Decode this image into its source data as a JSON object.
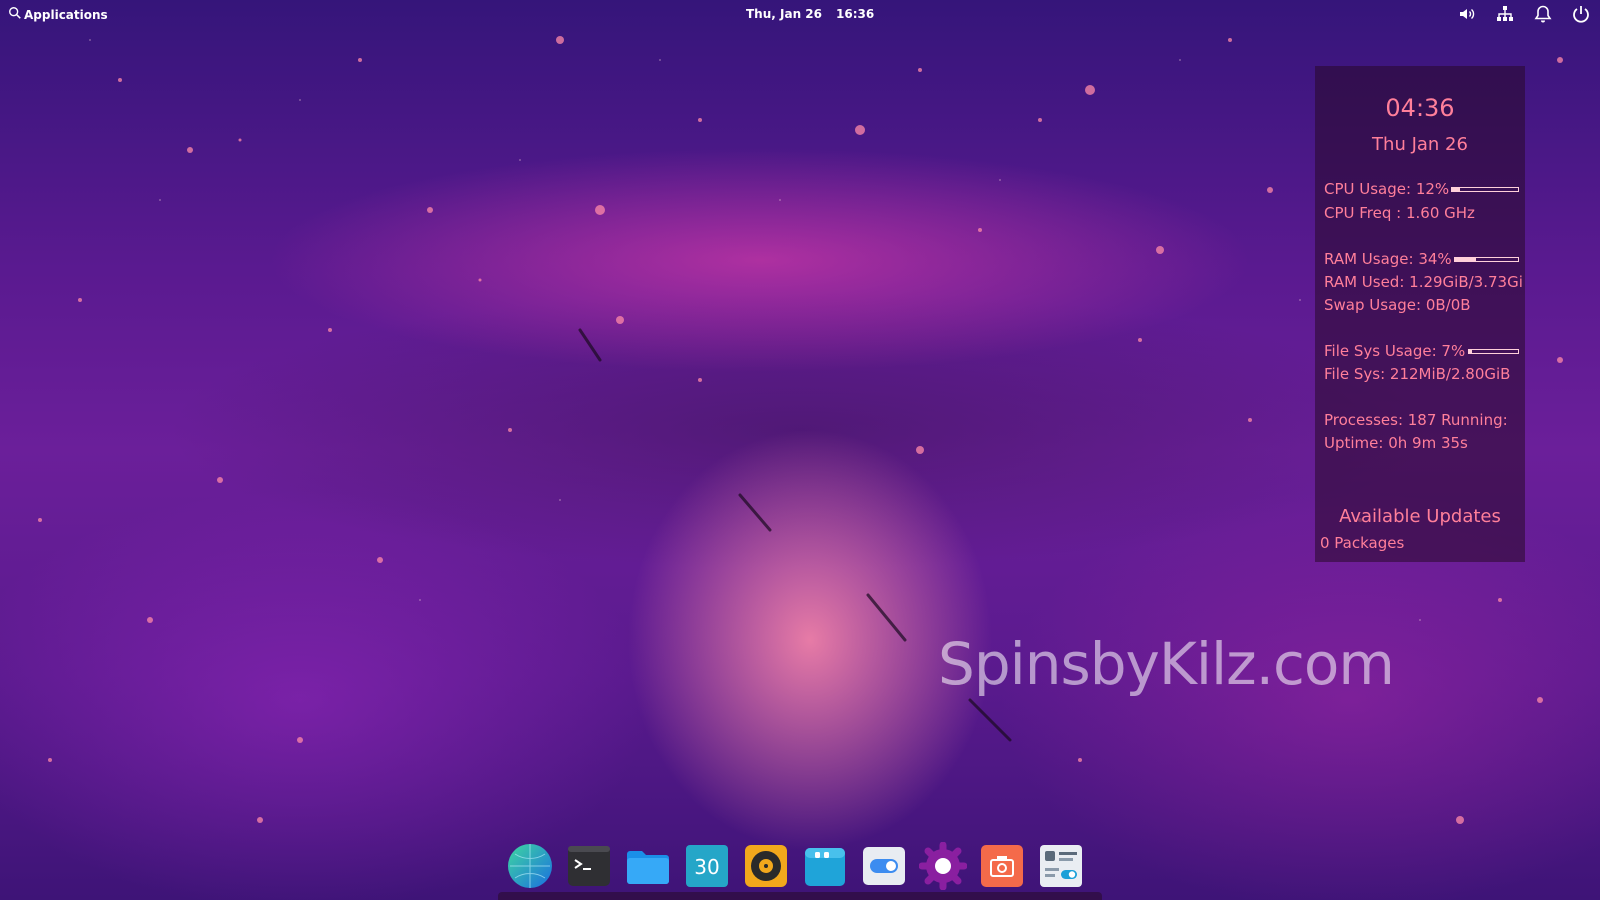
{
  "top_panel": {
    "apps_label": "Applications",
    "date": "Thu, Jan 26",
    "time": "16:36",
    "indicators": [
      {
        "icon": "speaker-icon"
      },
      {
        "icon": "network-icon"
      },
      {
        "icon": "bell-icon"
      },
      {
        "icon": "power-icon"
      }
    ]
  },
  "conky": {
    "time": "04:36",
    "date": "Thu Jan 26",
    "cpu_usage": "CPU Usage: 12%",
    "cpu_usage_pct": 12,
    "cpu_freq": "CPU Freq : 1.60 GHz",
    "ram_usage": "RAM Usage: 34%",
    "ram_usage_pct": 34,
    "ram_used": "RAM Used: 1.29GiB/3.73Gi",
    "swap_usage": "Swap Usage: 0B/0B",
    "fs_usage": "File Sys Usage:  7%",
    "fs_usage_pct": 7,
    "fs": "File Sys: 212MiB/2.80GiB",
    "processes": "Processes: 187   Running:",
    "uptime": "Uptime: 0h 9m 35s",
    "updates_title": "Available Updates",
    "updates_count": "0 Packages",
    "text_color": "#ff7f9a"
  },
  "watermark": "SpinsbyKilz.com",
  "dock": {
    "items": [
      {
        "name": "web-browser-icon"
      },
      {
        "name": "terminal-icon"
      },
      {
        "name": "files-icon"
      },
      {
        "name": "calendar-icon",
        "day": "30"
      },
      {
        "name": "music-icon"
      },
      {
        "name": "app-center-icon"
      },
      {
        "name": "toggle-settings-icon"
      },
      {
        "name": "settings-gear-icon"
      },
      {
        "name": "camera-icon"
      },
      {
        "name": "tweaks-icon"
      }
    ]
  }
}
